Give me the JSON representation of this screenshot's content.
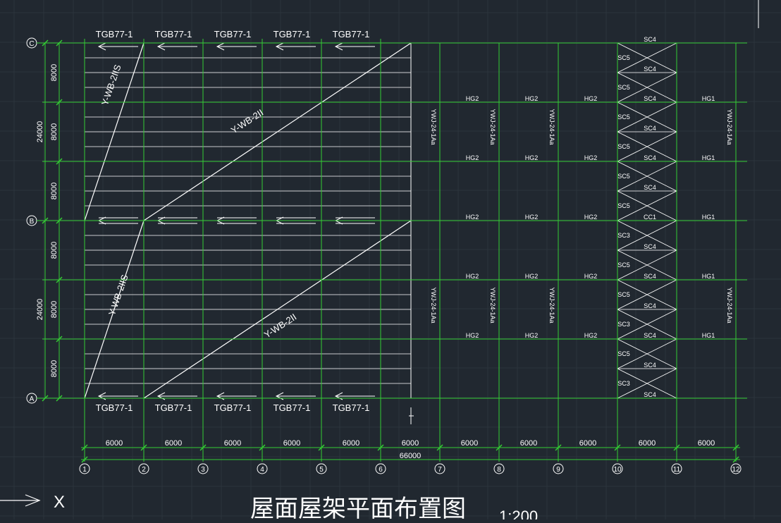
{
  "drawing": {
    "title": "屋面屋架平面布置图",
    "scale": "1:200",
    "colors": {
      "background": "#212830",
      "grid": "#33cc33",
      "line": "#ffffff",
      "gridmesh": "#2c343c"
    }
  },
  "axes": {
    "columns": [
      "1",
      "2",
      "3",
      "4",
      "5",
      "6",
      "7",
      "8",
      "9",
      "10",
      "11",
      "12"
    ],
    "rows": [
      "C",
      "B",
      "A"
    ]
  },
  "dims": {
    "bays": [
      "6000",
      "6000",
      "6000",
      "6000",
      "6000",
      "6000",
      "6000",
      "6000",
      "6000",
      "6000",
      "6000"
    ],
    "total": "66000",
    "left_small": [
      "8000",
      "8000",
      "8000",
      "8000",
      "8000",
      "8000"
    ],
    "left_big": [
      "24000",
      "24000"
    ]
  },
  "labels": {
    "tgb": "TGB77-1",
    "ywb_2": "Y-WB-2II",
    "ywb_2s": "Y-WB-2IIS",
    "ywj": "YWJ-24-1Aa",
    "hg1": "HG1",
    "hg2": "HG2",
    "sc4": "SC4",
    "sc5": "SC5",
    "sc3": "SC3",
    "cc1": "CC1",
    "ucs_x": "X"
  }
}
